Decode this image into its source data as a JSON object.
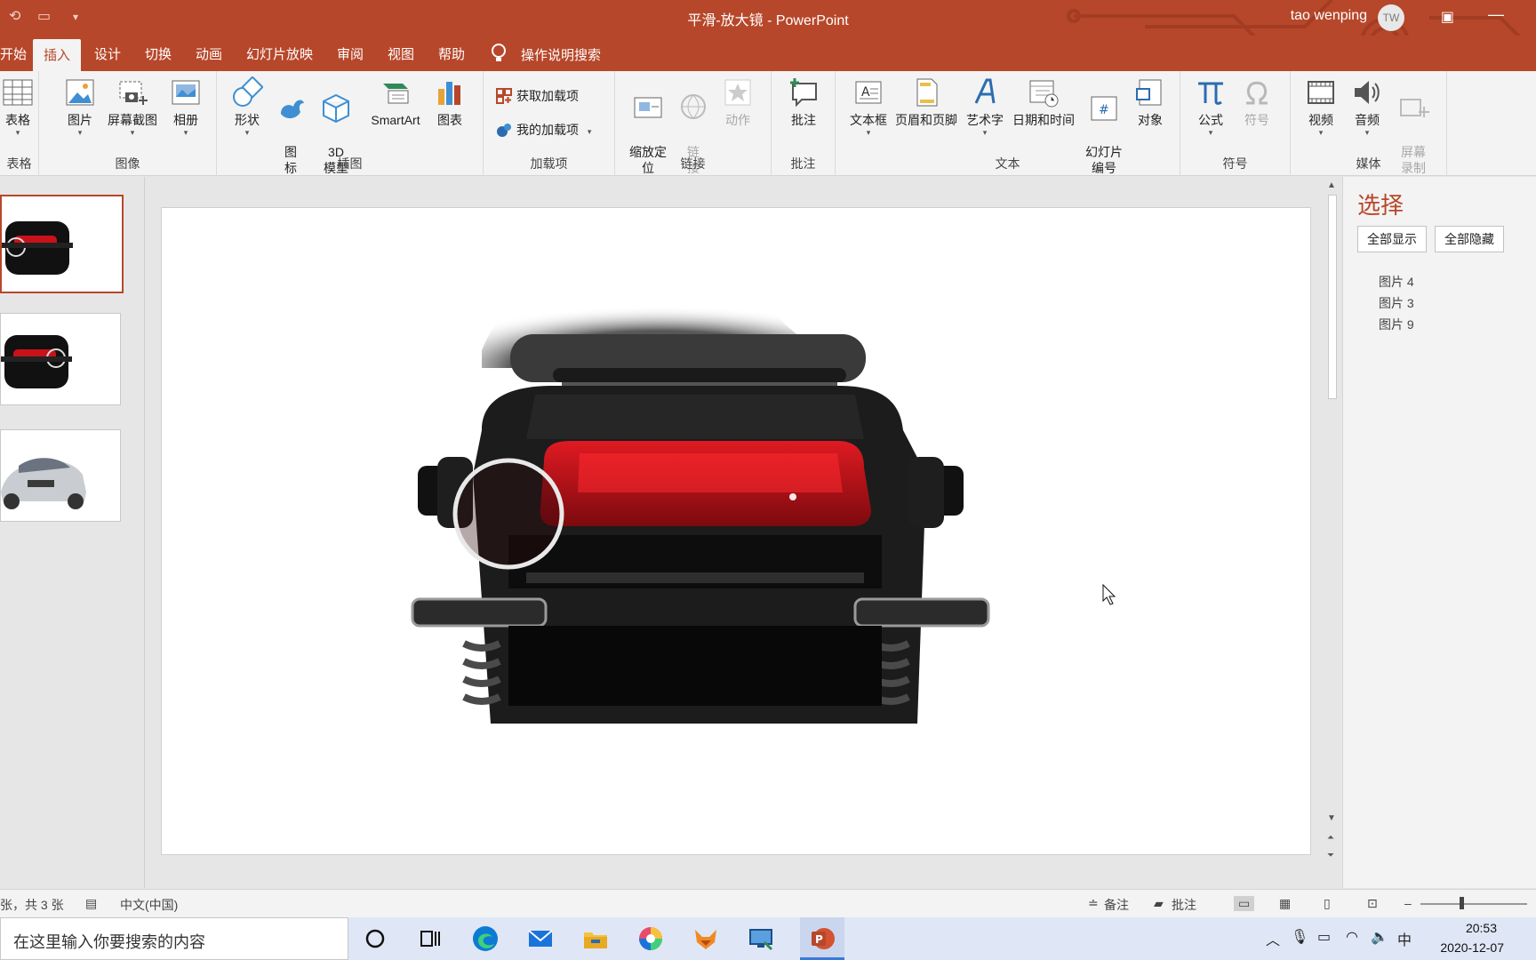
{
  "window": {
    "title": "平滑-放大镜  -  PowerPoint",
    "user_name": "tao wenping",
    "user_initials": "TW"
  },
  "tabs": [
    "开始",
    "插入",
    "设计",
    "切换",
    "动画",
    "幻灯片放映",
    "审阅",
    "视图",
    "帮助"
  ],
  "active_tab": "插入",
  "tell_me": "操作说明搜索",
  "ribbon": {
    "tables": {
      "label": "表格",
      "buttons": [
        "表格"
      ]
    },
    "images": {
      "label": "图像",
      "buttons": [
        "图片",
        "屏幕截图",
        "相册"
      ]
    },
    "illustrations": {
      "label": "插图",
      "buttons": [
        "形状",
        "图\n标",
        "3D\n模型",
        "SmartArt",
        "图表"
      ]
    },
    "addins": {
      "label": "加载项",
      "get": "获取加载项",
      "my": "我的加载项"
    },
    "links": {
      "label": "链接",
      "buttons": [
        "缩放定\n位",
        "链\n接",
        "动作"
      ]
    },
    "comments": {
      "label": "批注",
      "buttons": [
        "批注"
      ]
    },
    "text": {
      "label": "文本",
      "buttons": [
        "文本框",
        "页眉和页脚",
        "艺术字",
        "日期和时间",
        "幻灯片\n编号",
        "对象"
      ]
    },
    "symbols": {
      "label": "符号",
      "buttons": [
        "公式",
        "符号"
      ]
    },
    "media": {
      "label": "媒体",
      "buttons": [
        "视频",
        "音频",
        "屏幕\n录制"
      ]
    }
  },
  "selection_pane": {
    "title": "选择",
    "show_all": "全部显示",
    "hide_all": "全部隐藏",
    "objects": [
      "图片 4",
      "图片 3",
      "图片 9"
    ]
  },
  "status": {
    "slide_info": "张，共 3 张",
    "language": "中文(中国)",
    "notes": "备注",
    "comments": "批注"
  },
  "taskbar": {
    "search_placeholder": "在这里输入你要搜索的内容",
    "ime": "中",
    "time": "20:53",
    "date": "2020-12-07"
  },
  "colors": {
    "accent": "#b7472a",
    "taskbar": "#dfe7f6"
  }
}
